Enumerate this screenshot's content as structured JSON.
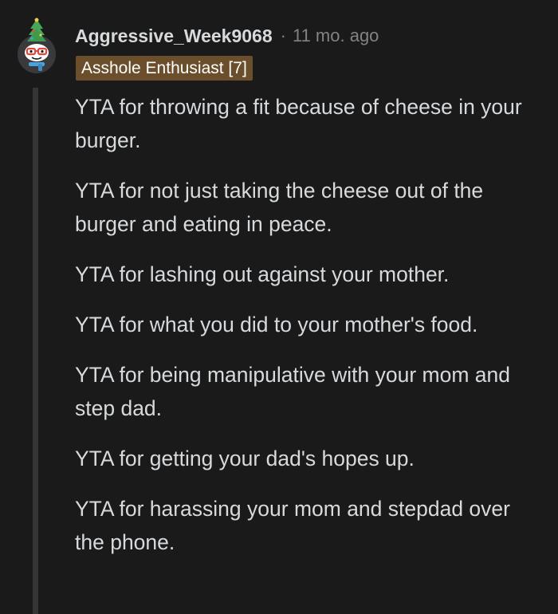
{
  "comment": {
    "username": "Aggressive_Week9068",
    "separator": "·",
    "timestamp": "11 mo. ago",
    "flair": "Asshole Enthusiast [7]",
    "avatar_icon": "snoo-avatar-with-christmas-tree-hat",
    "flair_color": "#6b4f2c",
    "background_color": "#1a1a1b",
    "paragraphs": [
      "YTA for throwing a fit because of cheese in your burger.",
      "YTA for not just taking the cheese out of the burger and eating in peace.",
      "YTA for lashing out against your mother.",
      "YTA for what you did to your mother's food.",
      "YTA for being manipulative with your mom and step dad.",
      "YTA for getting your dad's hopes up.",
      "YTA for harassing your mom and stepdad over the phone."
    ]
  }
}
